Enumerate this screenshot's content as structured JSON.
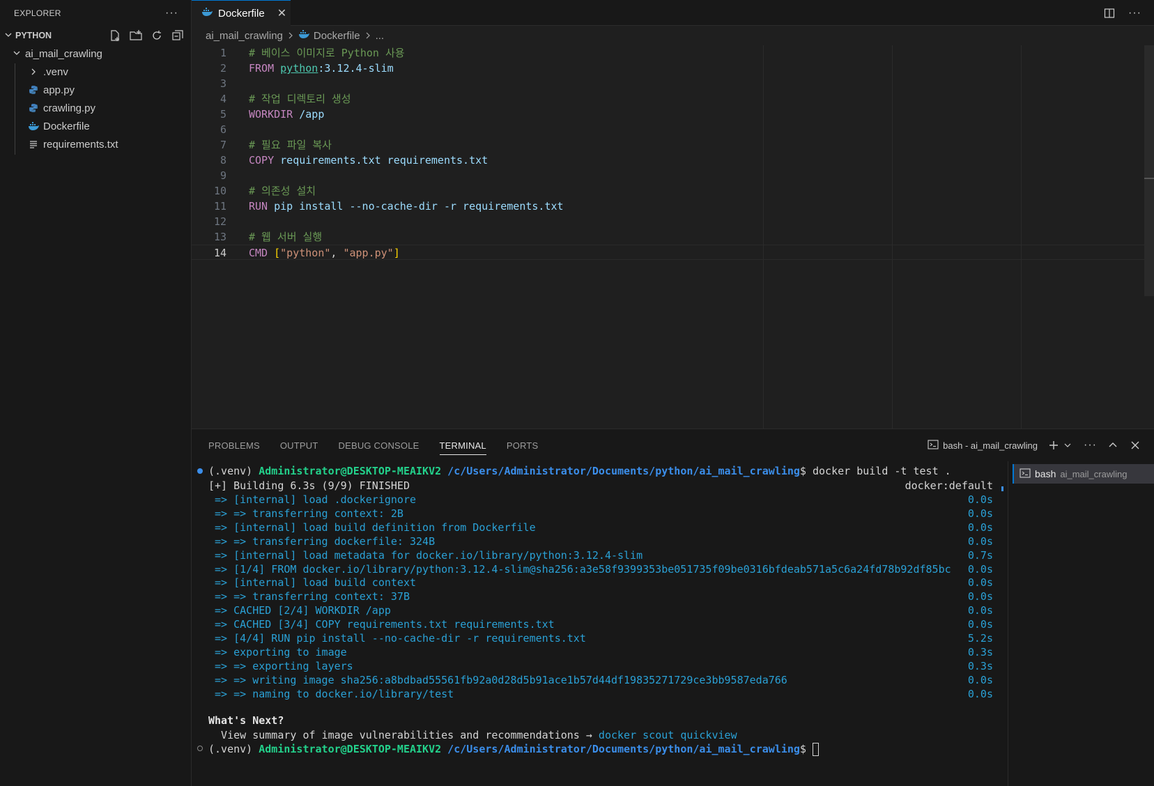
{
  "sidebar": {
    "title": "EXPLORER",
    "more": "···",
    "section": "PYTHON",
    "folder": "ai_mail_crawling",
    "items": [
      {
        "label": ".venv",
        "icon": "chevron-right-icon"
      },
      {
        "label": "app.py",
        "icon": "python-file-icon"
      },
      {
        "label": "crawling.py",
        "icon": "python-file-icon"
      },
      {
        "label": "Dockerfile",
        "icon": "docker-icon"
      },
      {
        "label": "requirements.txt",
        "icon": "text-file-icon"
      }
    ]
  },
  "tab": {
    "label": "Dockerfile",
    "close": "✕"
  },
  "tab_actions": {
    "more": "···"
  },
  "breadcrumb": {
    "folder": "ai_mail_crawling",
    "file": "Dockerfile",
    "more": "..."
  },
  "editor": {
    "line_numbers": [
      "1",
      "2",
      "3",
      "4",
      "5",
      "6",
      "7",
      "8",
      "9",
      "10",
      "11",
      "12",
      "13",
      "14"
    ],
    "active_line": 14,
    "l1": "# 베이스 이미지로 Python 사용",
    "l2_kw": "FROM",
    "l2_img": "python",
    "l2_tag": ":3.12.4-slim",
    "l4": "# 작업 디렉토리 생성",
    "l5_kw": "WORKDIR",
    "l5_arg": "/app",
    "l7": "# 필요 파일 복사",
    "l8_kw": "COPY",
    "l8_arg": "requirements.txt requirements.txt",
    "l10": "# 의존성 설치",
    "l11_kw": "RUN",
    "l11_arg": "pip install --no-cache-dir -r requirements.txt",
    "l13": "# 웹 서버 실행",
    "l14_kw": "CMD",
    "l14_open": "[",
    "l14_a": "\"python\"",
    "l14_sep": ", ",
    "l14_b": "\"app.py\"",
    "l14_close": "]"
  },
  "panel": {
    "tabs": [
      "PROBLEMS",
      "OUTPUT",
      "DEBUG CONSOLE",
      "TERMINAL",
      "PORTS"
    ],
    "active_tab": "TERMINAL",
    "terminal_name": "bash - ai_mail_crawling",
    "more": "···"
  },
  "terminal": {
    "venv": "(.venv) ",
    "user": "Administrator@DESKTOP-MEAIKV2",
    "path": " /c/Users/Administrator/Documents/python/ai_mail_crawling",
    "prompt": "$ ",
    "cmd": "docker build -t test .",
    "building": "[+] Building 6.3s (9/9) FINISHED",
    "builder": "docker:default",
    "steps": [
      {
        "text": " => [internal] load .dockerignore",
        "time": "0.0s"
      },
      {
        "text": " => => transferring context: 2B",
        "time": "0.0s"
      },
      {
        "text": " => [internal] load build definition from Dockerfile",
        "time": "0.0s"
      },
      {
        "text": " => => transferring dockerfile: 324B",
        "time": "0.0s"
      },
      {
        "text": " => [internal] load metadata for docker.io/library/python:3.12.4-slim",
        "time": "0.7s"
      },
      {
        "text": " => [1/4] FROM docker.io/library/python:3.12.4-slim@sha256:a3e58f9399353be051735f09be0316bfdeab571a5c6a24fd78b92df85bc",
        "time": "0.0s"
      },
      {
        "text": " => [internal] load build context",
        "time": "0.0s"
      },
      {
        "text": " => => transferring context: 37B",
        "time": "0.0s"
      },
      {
        "text": " => CACHED [2/4] WORKDIR /app",
        "time": "0.0s"
      },
      {
        "text": " => CACHED [3/4] COPY requirements.txt requirements.txt",
        "time": "0.0s"
      },
      {
        "text": " => [4/4] RUN pip install --no-cache-dir -r requirements.txt",
        "time": "5.2s"
      },
      {
        "text": " => exporting to image",
        "time": "0.3s"
      },
      {
        "text": " => => exporting layers",
        "time": "0.3s"
      },
      {
        "text": " => => writing image sha256:a8bdbad55561fb92a0d28d5b91ace1b57d44df19835271729ce3bb9587eda766",
        "time": "0.0s"
      },
      {
        "text": " => => naming to docker.io/library/test",
        "time": "0.0s"
      }
    ],
    "whats_next": "What's Next?",
    "hint": "  View summary of image vulnerabilities and recommendations → ",
    "hint_link": "docker scout quickview"
  },
  "terminal_list": {
    "name": "bash",
    "sub": "ai_mail_crawling"
  },
  "colors": {
    "accent": "#0078d4",
    "prompt_user": "#23d18b",
    "prompt_path": "#3b8eea",
    "build_output": "#2aa1d6"
  }
}
